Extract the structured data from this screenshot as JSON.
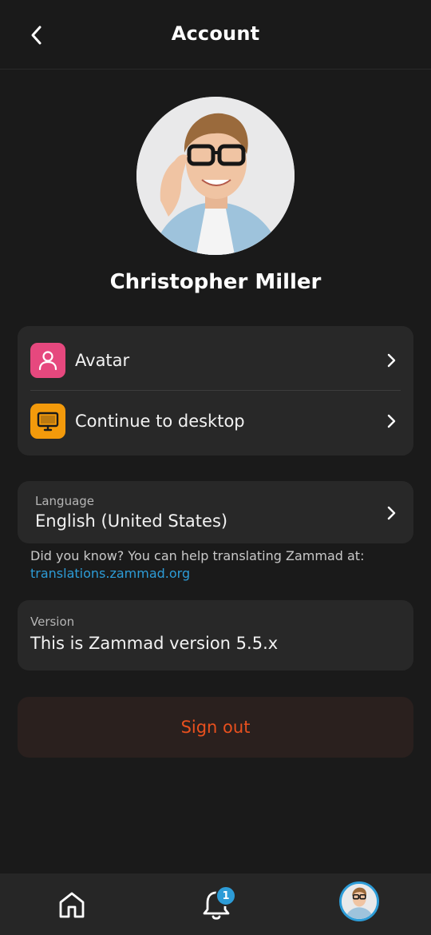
{
  "header": {
    "title": "Account",
    "back_icon": "chevron-left-icon"
  },
  "profile": {
    "name": "Christopher Miller",
    "avatar_image": "user-portrait-photo"
  },
  "menu": {
    "items": [
      {
        "label": "Avatar",
        "icon": "user-icon",
        "icon_color": "#e6487e"
      },
      {
        "label": "Continue to desktop",
        "icon": "monitor-icon",
        "icon_color": "#f39a0b"
      }
    ]
  },
  "language": {
    "caption": "Language",
    "value": "English (United States)"
  },
  "hint": {
    "text": "Did you know? You can help translating Zammad at:",
    "link": "translations.zammad.org"
  },
  "version": {
    "caption": "Version",
    "value": "This is Zammad version 5.5.x"
  },
  "signout": {
    "label": "Sign out",
    "color": "#e8501e"
  },
  "bottom_nav": {
    "items": [
      "home-icon",
      "bell-icon",
      "user-avatar"
    ],
    "notification_count": "1",
    "accent": "#2d9cd7"
  }
}
